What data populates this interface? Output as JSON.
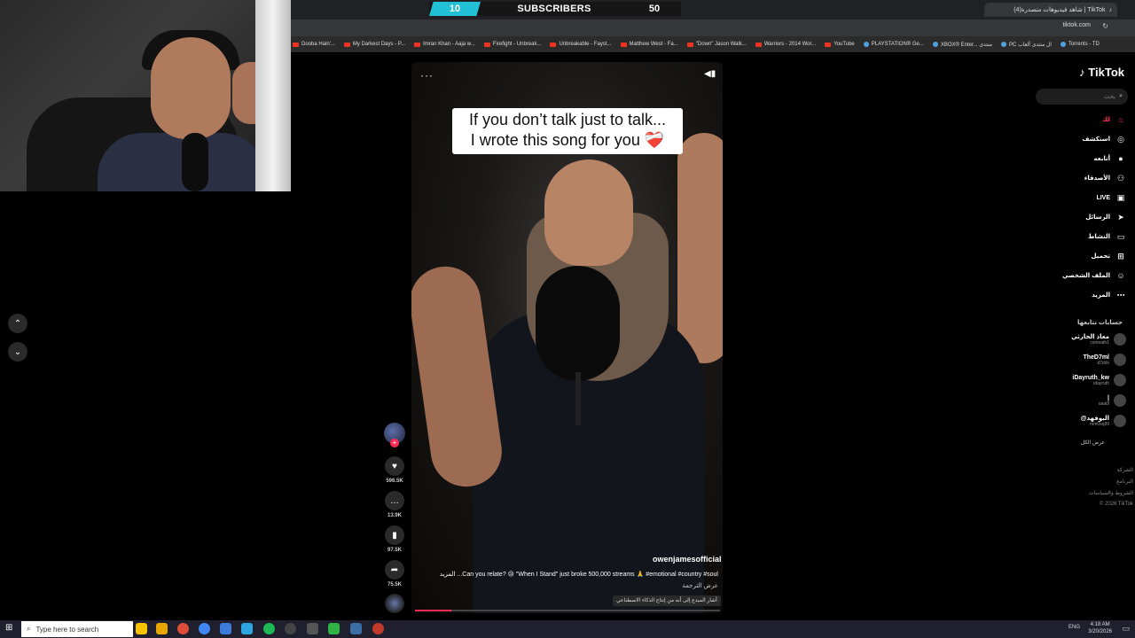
{
  "overlay": {
    "subs_current": "10",
    "subs_label": "SUBSCRIBERS",
    "subs_goal": "50"
  },
  "browser": {
    "tab_title": "(4)شاهد فيديوهات متصدرة | TikTok",
    "address": "tiktok.com",
    "bookmarks": [
      {
        "label": "Dooba Hain'...",
        "icon": "yt"
      },
      {
        "label": "My Darkest Days - P...",
        "icon": "yt"
      },
      {
        "label": "Imran Khan - Aaja w...",
        "icon": "yt"
      },
      {
        "label": "Firefight - Unbreak...",
        "icon": "yt"
      },
      {
        "label": "Unbreakable - Fayst...",
        "icon": "yt"
      },
      {
        "label": "Matthew West - Fa...",
        "icon": "yt"
      },
      {
        "label": "\"Down\" Jason Walk...",
        "icon": "yt"
      },
      {
        "label": "Warriors - 2014 Wor...",
        "icon": "yt"
      },
      {
        "label": "YouTube",
        "icon": "yt"
      },
      {
        "label": "PLAYSTATION® Ge...",
        "icon": "pc"
      },
      {
        "label": "XBOX® Enter... منتدى",
        "icon": "pc"
      },
      {
        "label": "PC ال منتدى ألعاب",
        "icon": "pc"
      },
      {
        "label": "Torrents - TD",
        "icon": "pc"
      }
    ]
  },
  "video": {
    "caption_line1": "If you don’t talk just to talk...",
    "caption_line2": "I wrote this song for you ❤️‍🩹",
    "author": "owenjamesofficial",
    "description": "Can you relate? 😢 \"When I Stand\" just broke 500,000 streams 🙏 #emotional #country #soul... المزيد",
    "translate": "عرض الترجمة",
    "ai_label": "أشار المبدع إلى أنه من إنتاج الذكاء الاصطناعي",
    "progress": 0.12,
    "likes": "596.5K",
    "comments": "13.9K",
    "saves": "97.5K",
    "shares": "75.5K"
  },
  "sidebar": {
    "logo": "TikTok",
    "search_placeholder": "بحث",
    "nav": [
      {
        "label": "لك",
        "icon": "home-icon",
        "glyph": "⌂",
        "active": true
      },
      {
        "label": "استكشف",
        "icon": "compass-icon",
        "glyph": "◎"
      },
      {
        "label": "أتابعه",
        "icon": "following-icon",
        "glyph": "●"
      },
      {
        "label": "الأصدقاء",
        "icon": "friends-icon",
        "glyph": "⚇"
      },
      {
        "label": "LIVE",
        "icon": "live-icon",
        "glyph": "▣"
      },
      {
        "label": "الرسائل",
        "icon": "messages-icon",
        "glyph": "➤"
      },
      {
        "label": "النشاط",
        "icon": "activity-icon",
        "glyph": "▭"
      },
      {
        "label": "تحميل",
        "icon": "upload-icon",
        "glyph": "⊞"
      },
      {
        "label": "الملف الشخصي",
        "icon": "profile-icon",
        "glyph": "☺"
      },
      {
        "label": "المزيد",
        "icon": "more-icon",
        "glyph": "⋯"
      }
    ],
    "following_heading": "حسابات تتابعها",
    "accounts": [
      {
        "name": "معاذ الحارثي",
        "handle": "csmoath1"
      },
      {
        "name": "TheD7ml",
        "handle": "d7ddv"
      },
      {
        "name": "iDayruth_kw",
        "handle": "idayruth"
      },
      {
        "name": "|",
        "handle": "oaa0l"
      },
      {
        "name": "@البوفهد",
        "handle": "mm0xq89"
      }
    ],
    "see_all": "عرض الكل",
    "footer": [
      "الشركة",
      "البرنامج",
      "الشروط والسياسات",
      "© 2026 TikTok"
    ]
  },
  "taskbar": {
    "search_placeholder": "Type here to search",
    "lang": "ENG",
    "time": "4:18 AM",
    "date": "3/20/2026"
  },
  "colors": {
    "accent": "#fe2c55",
    "subs_bar": "#22c0d4"
  }
}
